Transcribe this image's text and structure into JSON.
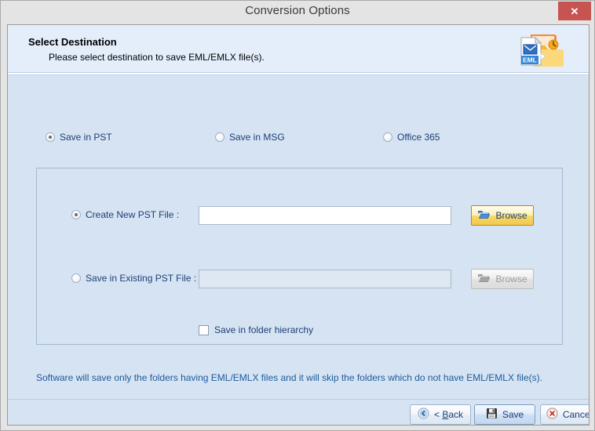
{
  "window": {
    "title": "Conversion Options",
    "close_label": "✕"
  },
  "header": {
    "title": "Select Destination",
    "subtitle": "Please select destination to save EML/EMLX file(s).",
    "icon": "eml-to-folder-icon"
  },
  "destination_options": [
    {
      "label": "Save in PST",
      "checked": true,
      "name": "radio-save-in-pst"
    },
    {
      "label": "Save in MSG",
      "checked": false,
      "name": "radio-save-in-msg"
    },
    {
      "label": "Office 365",
      "checked": false,
      "name": "radio-office-365"
    }
  ],
  "pst_panel": {
    "create_new": {
      "label": "Create New PST File :",
      "checked": true,
      "input_value": "",
      "input_placeholder": "",
      "browse_label": "Browse",
      "enabled": true
    },
    "existing": {
      "label": "Save in Existing PST File :",
      "checked": false,
      "input_value": "",
      "input_placeholder": "",
      "browse_label": "Browse",
      "enabled": false
    },
    "folder_hierarchy": {
      "label": "Save in folder hierarchy",
      "checked": false
    }
  },
  "note": "Software will save only the folders having EML/EMLX files and it will skip the folders which do not have EML/EMLX file(s).",
  "footer": {
    "back_prefix": "< ",
    "back_accel": "B",
    "back_suffix": "ack",
    "save_label": "Save",
    "cancel_label": "Cancel"
  },
  "colors": {
    "titlebar_bg": "#e4e4e4",
    "close_bg": "#c75450",
    "header_bg": "#e4eefb",
    "body_bg": "#d6e3f2",
    "label_blue": "#1c3f77",
    "note_blue": "#1c5b9c",
    "browse_gold": "#f2c94c"
  }
}
